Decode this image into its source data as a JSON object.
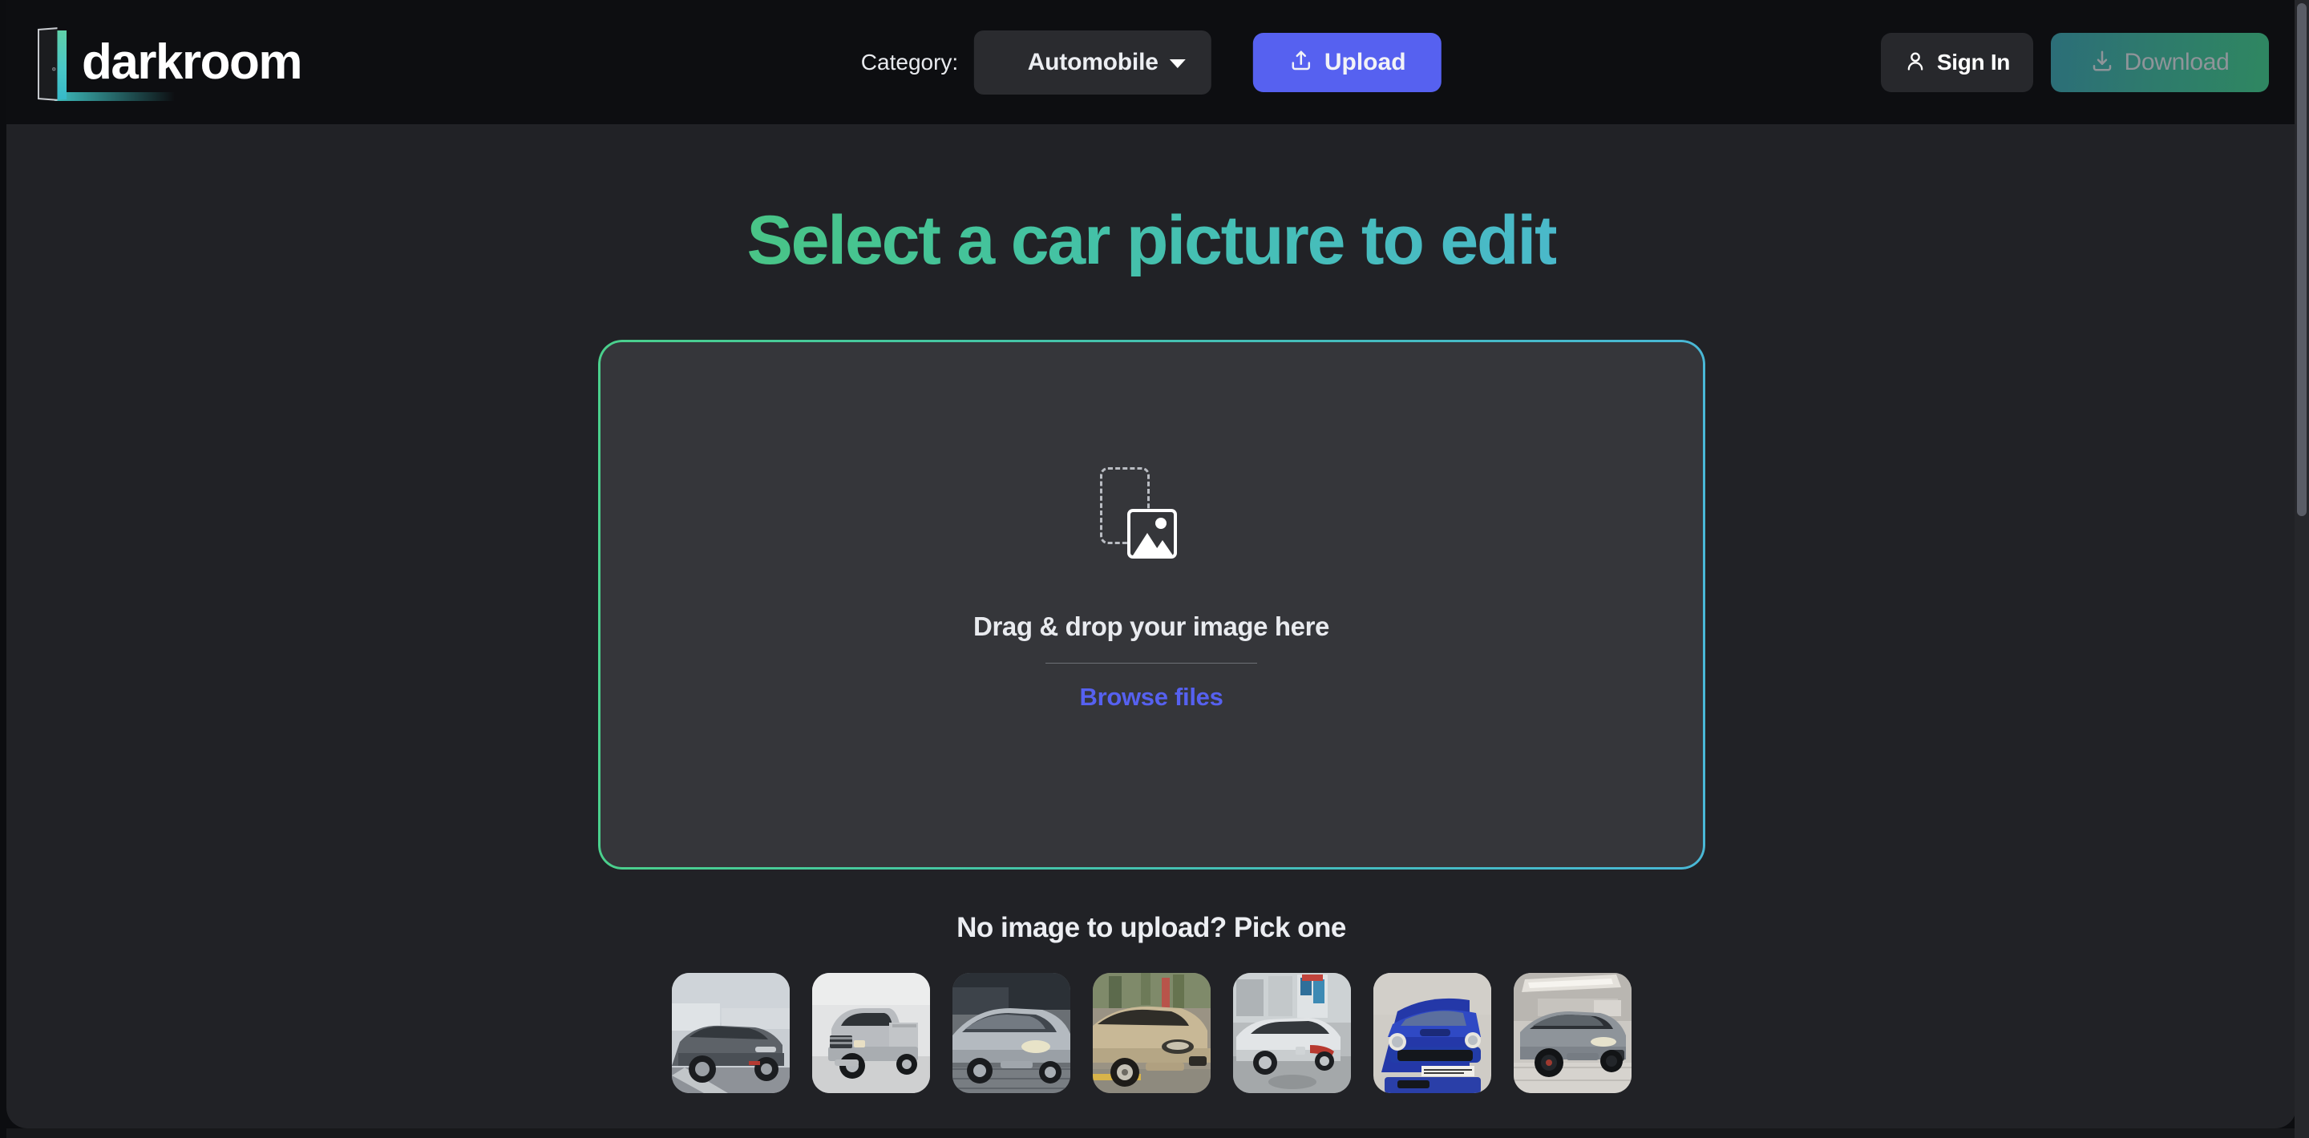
{
  "brand": {
    "name": "darkroom",
    "logo_icon": "open-door-icon"
  },
  "header": {
    "category_label": "Category:",
    "category_value": "Automobile",
    "category_options": [
      "Automobile"
    ],
    "upload_label": "Upload",
    "upload_icon": "upload-arrow-icon",
    "signin_label": "Sign In",
    "signin_icon": "user-icon",
    "download_label": "Download",
    "download_icon": "download-arrow-icon",
    "download_disabled": true
  },
  "main": {
    "headline": "Select a car picture to edit",
    "dropzone": {
      "icon": "image-placeholder-icon",
      "title": "Drag & drop your image here",
      "browse_label": "Browse files"
    },
    "gallery": {
      "title": "No image to upload? Pick one",
      "thumbnails": [
        {
          "name": "gray-suv-dealership",
          "alt": "Gray SUV at dealership lot"
        },
        {
          "name": "silver-pickup-truck",
          "alt": "Silver pickup truck in showroom"
        },
        {
          "name": "silver-sedan-front",
          "alt": "Silver sedan front quarter view"
        },
        {
          "name": "gold-sedan-street",
          "alt": "Gold sedan parked on street"
        },
        {
          "name": "white-sedan-rear",
          "alt": "White sedan rear quarter view"
        },
        {
          "name": "blue-mini-cooper",
          "alt": "Blue Mini Cooper with approved used sign"
        },
        {
          "name": "gray-jaguar-suv",
          "alt": "Gray Jaguar SUV in showroom"
        }
      ]
    }
  },
  "colors": {
    "accent_blue": "#5661f0",
    "accent_green": "#49c486",
    "accent_teal": "#4ab9ca",
    "header_bg": "#0d0e11",
    "page_bg": "#212226",
    "dropzone_bg": "#35363a"
  }
}
